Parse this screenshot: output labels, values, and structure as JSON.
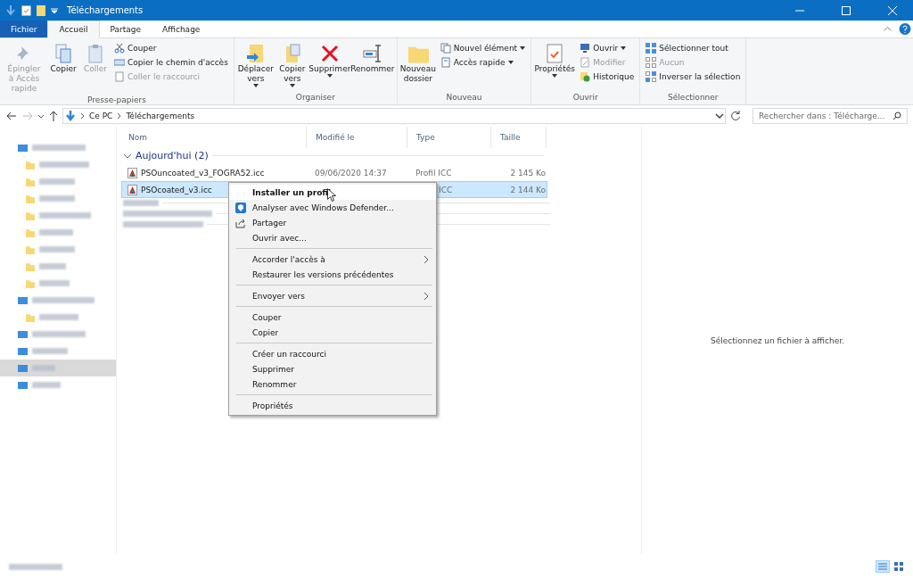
{
  "window": {
    "title": "Téléchargements"
  },
  "tabs": [
    {
      "label": "Fichier",
      "kind": "file",
      "selected": false
    },
    {
      "label": "Accueil",
      "kind": "tab",
      "selected": true
    },
    {
      "label": "Partage",
      "kind": "tab",
      "selected": false
    },
    {
      "label": "Affichage",
      "kind": "tab",
      "selected": false
    }
  ],
  "ribbon": [
    {
      "name": "Presse-papiers",
      "items": [
        {
          "kind": "large",
          "label": "Épingler à Accès rapide",
          "disabled": true,
          "dropdown": false
        },
        {
          "kind": "large",
          "label": "Copier",
          "disabled": false,
          "dropdown": false
        },
        {
          "kind": "large",
          "label": "Coller",
          "disabled": true,
          "dropdown": false
        },
        {
          "kind": "small",
          "label": "Couper",
          "disabled": false,
          "dropdown": false
        },
        {
          "kind": "small",
          "label": "Copier le chemin d'accès",
          "disabled": false,
          "dropdown": false
        },
        {
          "kind": "small",
          "label": "Coller le raccourci",
          "disabled": true,
          "dropdown": false
        }
      ]
    },
    {
      "name": "Organiser",
      "items": [
        {
          "kind": "large",
          "label": "Déplacer vers",
          "disabled": false,
          "dropdown": true
        },
        {
          "kind": "large",
          "label": "Copier vers",
          "disabled": false,
          "dropdown": true
        },
        {
          "kind": "large",
          "label": "Supprimer",
          "disabled": false,
          "dropdown": true
        },
        {
          "kind": "large",
          "label": "Renommer",
          "disabled": false,
          "dropdown": false
        }
      ]
    },
    {
      "name": "Nouveau",
      "items": [
        {
          "kind": "large",
          "label": "Nouveau dossier",
          "disabled": false,
          "dropdown": false
        },
        {
          "kind": "small",
          "label": "Nouvel élément",
          "disabled": false,
          "dropdown": true
        },
        {
          "kind": "small",
          "label": "Accès rapide",
          "disabled": false,
          "dropdown": true
        }
      ]
    },
    {
      "name": "Ouvrir",
      "items": [
        {
          "kind": "large",
          "label": "Propriétés",
          "disabled": false,
          "dropdown": true
        },
        {
          "kind": "small",
          "label": "Ouvrir",
          "disabled": false,
          "dropdown": true
        },
        {
          "kind": "small",
          "label": "Modifier",
          "disabled": true,
          "dropdown": false
        },
        {
          "kind": "small",
          "label": "Historique",
          "disabled": false,
          "dropdown": false
        }
      ]
    },
    {
      "name": "Sélectionner",
      "items": [
        {
          "kind": "small",
          "label": "Sélectionner tout",
          "disabled": false,
          "dropdown": false
        },
        {
          "kind": "small",
          "label": "Aucun",
          "disabled": true,
          "dropdown": false
        },
        {
          "kind": "small",
          "label": "Inverser la sélection",
          "disabled": false,
          "dropdown": false
        }
      ]
    }
  ],
  "address": {
    "path": [
      "Ce PC",
      "Téléchargements"
    ],
    "search_placeholder": "Rechercher dans : Télécharge..."
  },
  "sidebar": {
    "items": [
      {
        "selected": false,
        "children": [
          {
            "selected": false
          },
          {
            "selected": false
          },
          {
            "selected": false
          },
          {
            "selected": false
          },
          {
            "selected": false
          },
          {
            "selected": false
          },
          {
            "selected": false
          },
          {
            "selected": false
          }
        ]
      },
      {
        "selected": false,
        "children": [
          {
            "selected": false
          }
        ]
      },
      {
        "selected": false
      },
      {
        "selected": false
      },
      {
        "selected": true
      },
      {
        "selected": false
      }
    ]
  },
  "table": {
    "columns": [
      "Nom",
      "Modifié le",
      "Type",
      "Taille"
    ],
    "group": {
      "label": "Aujourd'hui (2)",
      "expanded": true
    },
    "rows": [
      {
        "name": "PSOuncoated_v3_FOGRA52.icc",
        "modified": "09/06/2020 14:37",
        "type": "Profil ICC",
        "size": "2 145 Ko",
        "selected": false
      },
      {
        "name": "PSOcoated_v3.icc",
        "type": "ICC",
        "size": "2 144 Ko",
        "selected": true
      }
    ]
  },
  "preview": {
    "message": "Sélectionnez un fichier à afficher."
  },
  "context_menu": {
    "sections": [
      [
        {
          "label": "Installer un profil",
          "default": true,
          "submenu": false
        },
        {
          "label": "Analyser avec Windows Defender...",
          "default": false,
          "submenu": false
        },
        {
          "label": "Partager",
          "default": false,
          "submenu": false
        },
        {
          "label": "Ouvrir avec...",
          "default": false,
          "submenu": false
        }
      ],
      [
        {
          "label": "Accorder l'accès à",
          "default": false,
          "submenu": true
        },
        {
          "label": "Restaurer les versions précédentes",
          "default": false,
          "submenu": false
        }
      ],
      [
        {
          "label": "Envoyer vers",
          "default": false,
          "submenu": true
        }
      ],
      [
        {
          "label": "Couper",
          "default": false,
          "submenu": false
        },
        {
          "label": "Copier",
          "default": false,
          "submenu": false
        }
      ],
      [
        {
          "label": "Créer un raccourci",
          "default": false,
          "submenu": false
        },
        {
          "label": "Supprimer",
          "default": false,
          "submenu": false
        },
        {
          "label": "Renommer",
          "default": false,
          "submenu": false
        }
      ],
      [
        {
          "label": "Propriétés",
          "default": false,
          "submenu": false
        }
      ]
    ]
  },
  "status_bar": {
    "views": [
      {
        "selected": true
      },
      {
        "selected": false
      }
    ]
  }
}
